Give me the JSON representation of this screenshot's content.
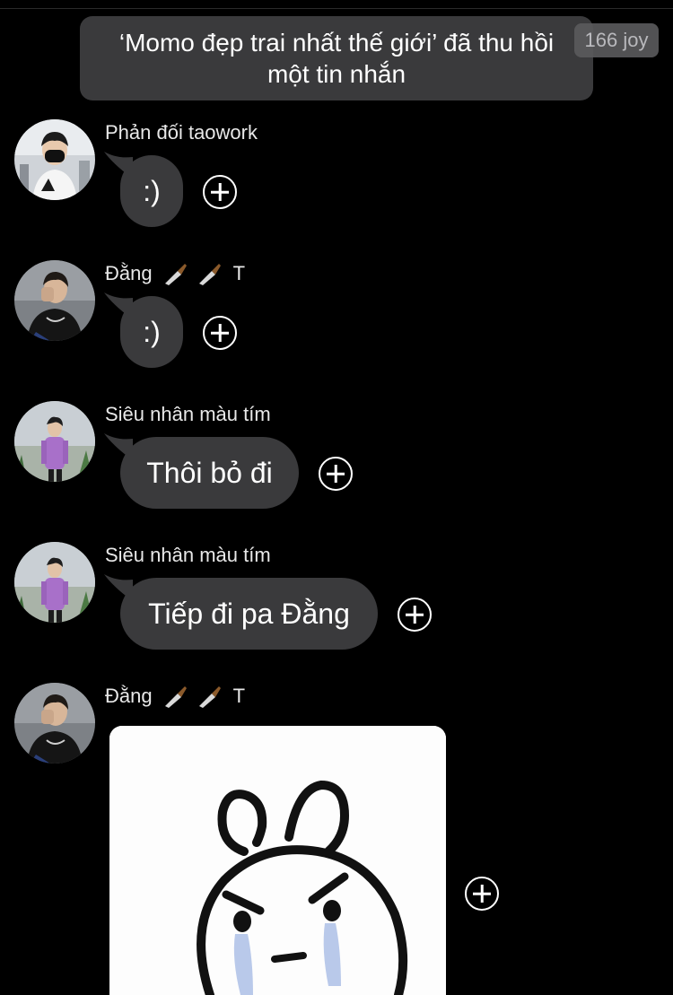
{
  "system_notice": {
    "line1": "‘Momo đẹp trai nhất thế giới’ đã thu hồi",
    "line2": "một tin nhắn"
  },
  "counter_badge": "166 joy",
  "messages": [
    {
      "sender": "Phản đối taowork",
      "text": ":)",
      "avatar": "avatar-masked-boy"
    },
    {
      "sender_prefix": "Đằng",
      "sender_suffix": "T",
      "sender_emoji": "knife-icon",
      "text": ":)",
      "avatar": "avatar-dang"
    },
    {
      "sender": "Siêu nhân màu tím",
      "text": "Thôi bỏ đi",
      "avatar": "avatar-purple-hoodie"
    },
    {
      "sender": "Siêu nhân màu tím",
      "text": "Tiếp đi pa Đằng",
      "avatar": "avatar-purple-hoodie"
    },
    {
      "sender_prefix": "Đằng",
      "sender_suffix": "T",
      "sender_emoji": "knife-icon",
      "attachment": "angry-crying-bunny-sticker",
      "avatar": "avatar-dang"
    }
  ],
  "colors": {
    "background": "#000000",
    "bubble": "#3a3a3c",
    "text": "#ffffff"
  }
}
